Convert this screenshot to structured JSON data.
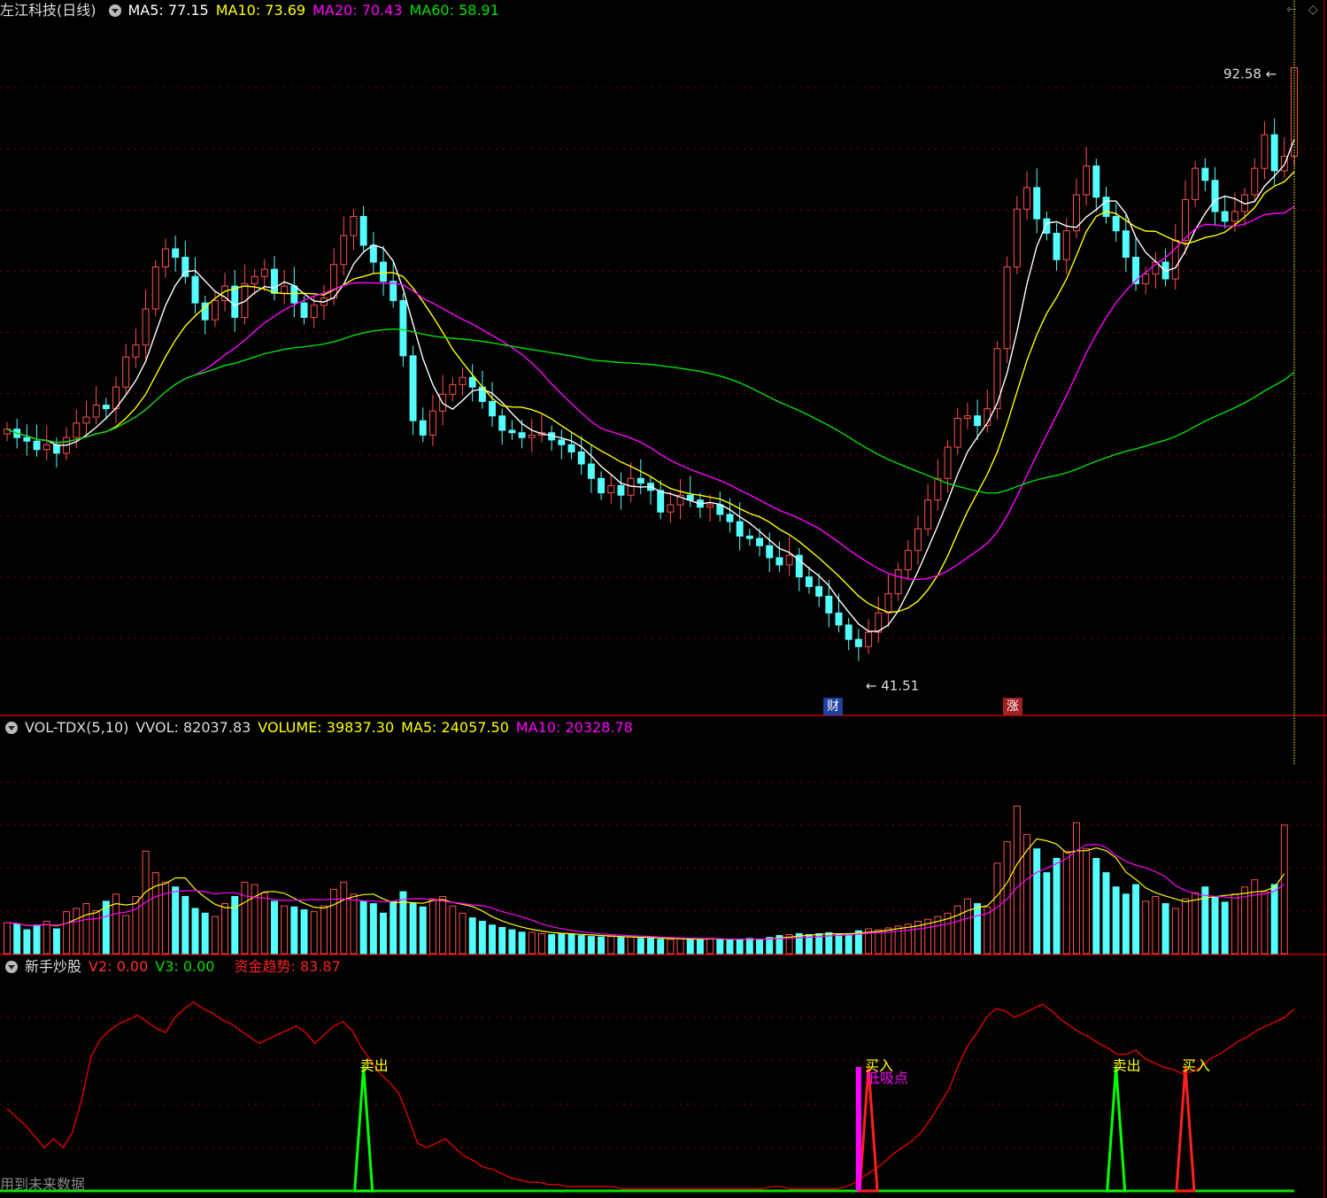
{
  "main_header": {
    "title": "左江科技(日线)",
    "ma5": "MA5: 77.15",
    "ma10": "MA10: 73.69",
    "ma20": "MA20: 70.43",
    "ma60": "MA60: 58.91"
  },
  "vol_header": {
    "name": "VOL-TDX(5,10)",
    "vvol": "VVOL: 82037.83",
    "volume": "VOLUME: 39837.30",
    "ma5": "MA5: 24057.50",
    "ma10": "MA10: 20328.78"
  },
  "ind_header": {
    "name": "新手炒股",
    "v2": "V2: 0.00",
    "v3": "V3: 0.00",
    "trend": "资金趋势: 83.87"
  },
  "footer_text": "用到未来数据",
  "markers": {
    "cai": "财",
    "zhang": "涨",
    "high": "92.58",
    "low": "41.51"
  },
  "signals": {
    "sell": "卖出",
    "buy": "买入",
    "absorb": "低吸点"
  },
  "colors": {
    "up": "#ff5050",
    "down": "#54ffff",
    "ma5": "#ffffff",
    "ma10": "#ffff00",
    "ma20": "#ff00ff",
    "ma60": "#00e000",
    "trend": "#e00000",
    "grid": "#8b0000"
  },
  "chart_data": [
    {
      "type": "candlestick",
      "title": "左江科技(日线)",
      "y_range": [
        40,
        96
      ],
      "high": 92.58,
      "low": 41.51,
      "closes": [
        62.5,
        61.8,
        61.5,
        60.8,
        61.2,
        60.5,
        61.8,
        63.0,
        63.5,
        64.5,
        64.2,
        66.0,
        68.5,
        69.5,
        72.5,
        76.0,
        77.5,
        76.8,
        75.2,
        73.0,
        71.6,
        73.2,
        74.4,
        71.8,
        74.6,
        75.2,
        75.8,
        73.8,
        74.4,
        73.0,
        71.8,
        72.8,
        73.4,
        76.2,
        78.6,
        80.2,
        77.8,
        76.4,
        74.8,
        73.2,
        68.6,
        63.2,
        62.0,
        64.0,
        65.4,
        66.2,
        66.8,
        66.0,
        64.8,
        63.6,
        62.4,
        62.2,
        61.8,
        62.0,
        62.2,
        61.6,
        61.2,
        60.6,
        59.6,
        58.4,
        57.2,
        57.8,
        57.0,
        58.4,
        58.0,
        57.4,
        55.6,
        56.2,
        57.0,
        56.6,
        56.0,
        56.2,
        55.4,
        54.8,
        53.6,
        53.4,
        52.8,
        51.8,
        51.2,
        52.0,
        50.2,
        49.4,
        48.6,
        47.2,
        46.2,
        45.0,
        44.4,
        45.6,
        47.2,
        48.8,
        50.8,
        52.4,
        54.2,
        56.6,
        58.4,
        61.0,
        63.4,
        63.6,
        62.8,
        64.2,
        69.2,
        76.0,
        80.8,
        82.6,
        80.0,
        78.8,
        76.6,
        79.0,
        82.0,
        84.4,
        81.8,
        80.2,
        79.0,
        76.8,
        74.6,
        75.4,
        76.4,
        75.0,
        78.2,
        81.6,
        84.2,
        83.2,
        80.6,
        79.8,
        80.6,
        82.0,
        84.2,
        87.0,
        84.0,
        85.2,
        92.58
      ],
      "series": [
        {
          "name": "MA5",
          "value": 77.15
        },
        {
          "name": "MA10",
          "value": 73.69
        },
        {
          "name": "MA20",
          "value": 70.43
        },
        {
          "name": "MA60",
          "value": 58.91
        }
      ]
    },
    {
      "type": "bar",
      "title": "VOL-TDX(5,10)",
      "y_range": [
        0,
        45000
      ],
      "values": [
        6500,
        6200,
        5000,
        6000,
        6800,
        5200,
        8800,
        9500,
        10500,
        9000,
        11000,
        12500,
        8000,
        12000,
        21500,
        17000,
        15000,
        14000,
        12000,
        9500,
        8500,
        7800,
        10500,
        12000,
        15000,
        14500,
        12800,
        11000,
        10000,
        9800,
        9200,
        8800,
        10000,
        13500,
        15000,
        12500,
        11000,
        10500,
        8500,
        11000,
        13000,
        10500,
        9800,
        11500,
        12000,
        10000,
        8500,
        7500,
        6800,
        6000,
        5500,
        5000,
        4500,
        4500,
        4200,
        4000,
        4200,
        4000,
        3800,
        3600,
        3500,
        3600,
        3400,
        3500,
        3200,
        3200,
        3000,
        3000,
        3100,
        3000,
        3000,
        3200,
        3000,
        2800,
        3000,
        3200,
        3000,
        3400,
        3800,
        4000,
        4200,
        4000,
        4200,
        4400,
        4000,
        4200,
        4800,
        5200,
        5000,
        5400,
        5800,
        6200,
        6800,
        7200,
        7800,
        8500,
        10000,
        11500,
        10500,
        9800,
        19000,
        23500,
        31000,
        25000,
        22000,
        17000,
        20000,
        21500,
        27500,
        22000,
        20000,
        17000,
        14000,
        12500,
        14500,
        11000,
        12000,
        10500,
        9500,
        11500,
        12800,
        14000,
        12000,
        10800,
        12500,
        14000,
        15500,
        13000,
        14500,
        27000
      ],
      "current_volume": 39837.3,
      "series": [
        {
          "name": "VVOL",
          "value": 82037.83
        },
        {
          "name": "MA5",
          "value": 24057.5
        },
        {
          "name": "MA10",
          "value": 20328.78
        }
      ]
    },
    {
      "type": "line",
      "title": "新手炒股",
      "y_range": [
        0,
        100
      ],
      "trend": [
        38,
        34,
        30,
        25,
        20,
        24,
        20,
        27,
        42,
        62,
        70,
        74,
        77,
        79,
        81,
        78,
        75,
        73,
        80,
        84,
        87,
        84,
        82,
        79,
        77,
        74,
        71,
        68,
        70,
        72,
        74,
        76,
        73,
        68,
        72,
        76,
        78,
        74,
        66,
        60,
        54,
        50,
        45,
        34,
        22,
        20,
        22,
        24,
        20,
        16,
        14,
        11,
        10,
        8,
        6,
        5,
        4,
        4,
        3,
        3,
        2,
        2,
        2,
        2,
        2,
        2,
        1,
        1,
        1,
        1,
        1,
        1,
        1,
        1,
        1,
        1,
        1,
        1,
        1,
        1,
        1,
        1,
        2,
        2,
        1,
        1,
        1,
        1,
        1,
        1,
        2,
        4,
        7,
        10,
        13,
        17,
        20,
        23,
        27,
        33,
        40,
        47,
        58,
        67,
        73,
        80,
        84,
        83,
        80,
        82,
        84,
        86,
        83,
        79,
        76,
        73,
        71,
        68,
        66,
        63,
        63,
        65,
        61,
        59,
        57,
        56,
        54,
        55,
        57,
        61,
        63,
        66,
        69,
        71,
        74,
        76,
        78,
        80,
        83.87
      ],
      "signals": [
        {
          "label": "卖出",
          "index": 36,
          "color": "green"
        },
        {
          "label": "买入",
          "index": 87,
          "color": "red"
        },
        {
          "label": "低吸点",
          "index": 86,
          "color": "magenta"
        },
        {
          "label": "卖出",
          "index": 112,
          "color": "green"
        },
        {
          "label": "买入",
          "index": 119,
          "color": "red"
        }
      ],
      "series": [
        {
          "name": "V2",
          "value": 0.0
        },
        {
          "name": "V3",
          "value": 0.0
        },
        {
          "name": "资金趋势",
          "value": 83.87
        }
      ]
    }
  ]
}
